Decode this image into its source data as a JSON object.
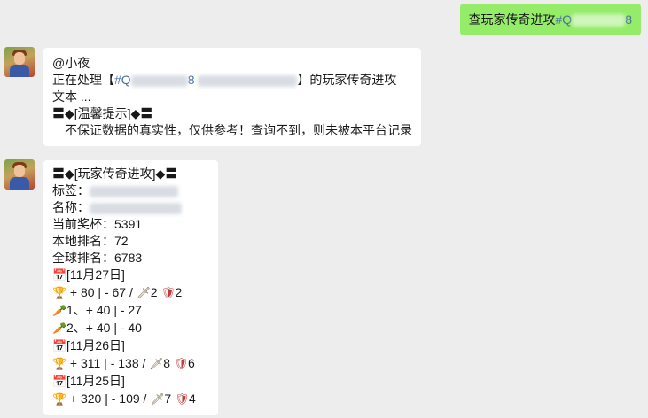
{
  "outgoing": {
    "prefix": "查玩家传奇进攻",
    "tag_start": "#Q",
    "tag_end": "8"
  },
  "reply1": {
    "mention": "@小夜",
    "line1_prefix": "正在处理【",
    "line1_tag_start": "#Q",
    "line1_tag_end": "8",
    "line1_suffix": "】的玩家传奇进攻",
    "line2": "文本 ...",
    "tip_header": "〓◆[温馨提示]◆〓",
    "tip_text": "不保证数据的真实性，仅供参考！查询不到，则未被本平台记录"
  },
  "reply2": {
    "header": "〓◆[玩家传奇进攻]◆〓",
    "tag_label": "标签：",
    "name_label": "名称：",
    "trophies": "当前奖杯：5391",
    "local_rank": "本地排名：72",
    "global_rank": "全球排名：6783",
    "days": [
      {
        "date": "[11月27日]",
        "summary": "+ 80 | - 67 /",
        "attacks": "2",
        "defenses": "2",
        "extra": [
          "1、+ 40 | - 27",
          "2、+ 40 | - 40"
        ]
      },
      {
        "date": "[11月26日]",
        "summary": "+ 311 | - 138 /",
        "attacks": "8",
        "defenses": "6"
      },
      {
        "date": "[11月25日]",
        "summary": "+ 320 | - 109 /",
        "attacks": "7",
        "defenses": "4"
      }
    ]
  },
  "icons": {
    "calendar": "📅",
    "trophy": "🏆",
    "sword": "🗡",
    "shield": "🛡",
    "carrot": "🥕"
  }
}
